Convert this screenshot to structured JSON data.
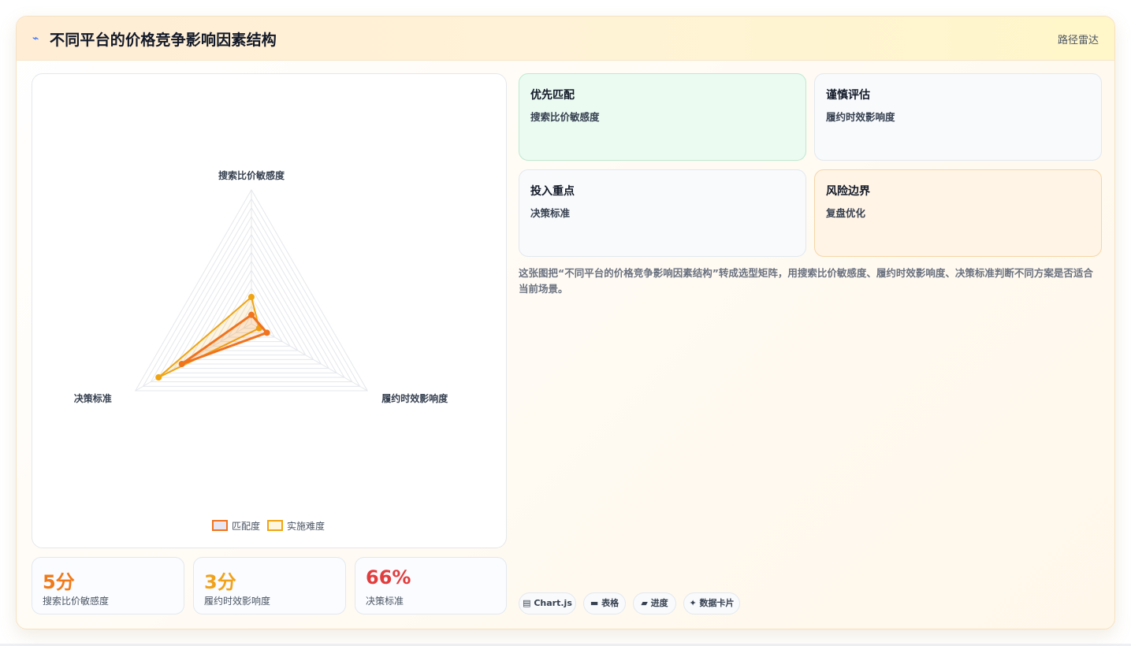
{
  "header": {
    "icon": "pulse-icon",
    "title": "不同平台的价格竞争影响因素结构",
    "mode": "路径雷达"
  },
  "chart_data": {
    "type": "radar",
    "axes": [
      "搜索比价敏感度",
      "履约时效影响度",
      "决策标准"
    ],
    "rmax": 15,
    "rings": 15,
    "series": [
      {
        "name": "匹配度",
        "values": [
          1,
          2,
          9
        ],
        "color": "#f0731e"
      },
      {
        "name": "实施难度",
        "values": [
          3,
          1,
          12
        ],
        "color": "#f0a412"
      }
    ],
    "legend_position": "bottom"
  },
  "kpis": [
    {
      "value": "5分",
      "label": "搜索比价敏感度",
      "color": "#f07a1a"
    },
    {
      "value": "3分",
      "label": "履约时效影响度",
      "color": "#f0a21a"
    },
    {
      "value": "66%",
      "label": "决策标准",
      "color": "#e23d3d"
    }
  ],
  "tiles": [
    {
      "title": "优先匹配",
      "text": "搜索比价敏感度"
    },
    {
      "title": "谨慎评估",
      "text": "履约时效影响度"
    },
    {
      "title": "投入重点",
      "text": "决策标准"
    },
    {
      "title": "风险边界",
      "text": "复盘优化"
    }
  ],
  "description": "这张图把“不同平台的价格竞争影响因素结构”转成选型矩阵，用搜索比价敏感度、履约时效影响度、决策标准判断不同方案是否适合当前场景。",
  "chips": [
    {
      "icon": "chart-icon",
      "glyph": "▤",
      "label": "Chart.js"
    },
    {
      "icon": "table-icon",
      "glyph": "▬",
      "label": "表格"
    },
    {
      "icon": "progress-icon",
      "glyph": "▰",
      "label": "进度"
    },
    {
      "icon": "sparkle-icon",
      "glyph": "✦",
      "label": "数据卡片"
    }
  ]
}
